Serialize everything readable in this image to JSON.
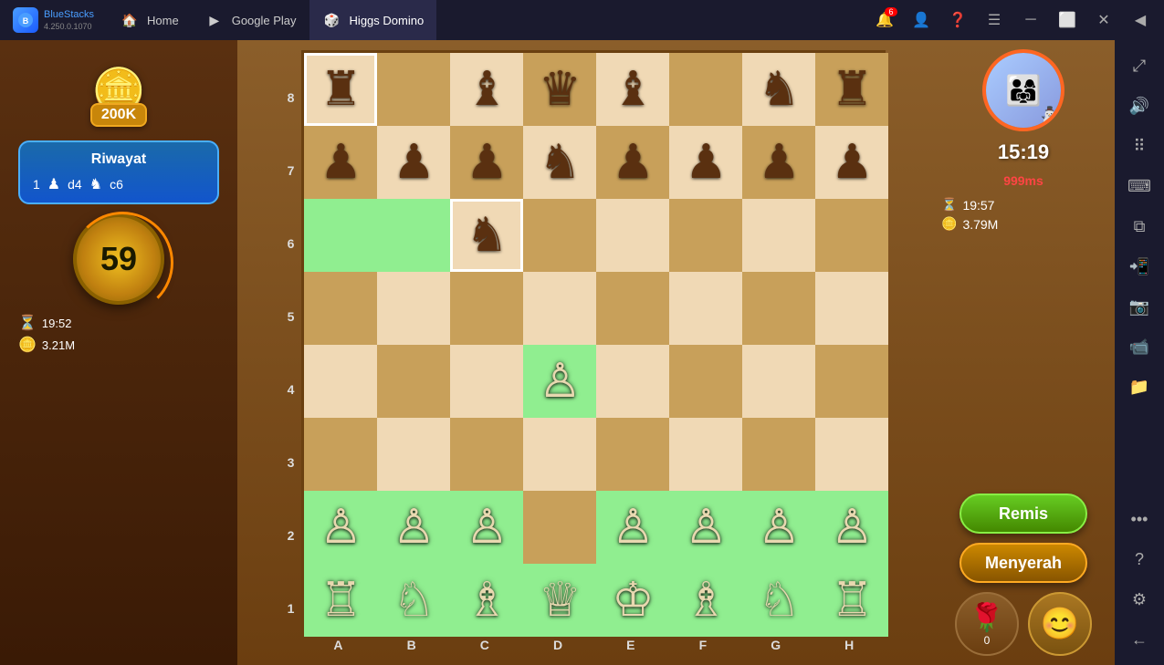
{
  "topbar": {
    "brand": {
      "name": "BlueStacks",
      "version": "4.250.0.1070"
    },
    "tabs": [
      {
        "id": "home",
        "label": "Home",
        "active": false
      },
      {
        "id": "google-play",
        "label": "Google Play",
        "active": false
      },
      {
        "id": "higgs-domino",
        "label": "Higgs Domino",
        "active": true
      }
    ],
    "notification_count": "6"
  },
  "left_panel": {
    "coins_label": "200K",
    "history_title": "Riwayat",
    "move_number": "1",
    "move_white": "d4",
    "move_black": "c6",
    "timer_value": "59",
    "time_remaining": "19:52",
    "coins": "3.21M"
  },
  "right_panel": {
    "time_display": "15:19",
    "latency": "999ms",
    "opp_time": "19:57",
    "opp_coins": "3.79M",
    "remis_label": "Remis",
    "menyerah_label": "Menyerah",
    "rose_count": "0"
  },
  "board": {
    "ranks": [
      "8",
      "7",
      "6",
      "5",
      "4",
      "3",
      "2",
      "1"
    ],
    "files": [
      "A",
      "B",
      "C",
      "D",
      "E",
      "F",
      "G",
      "H"
    ]
  }
}
